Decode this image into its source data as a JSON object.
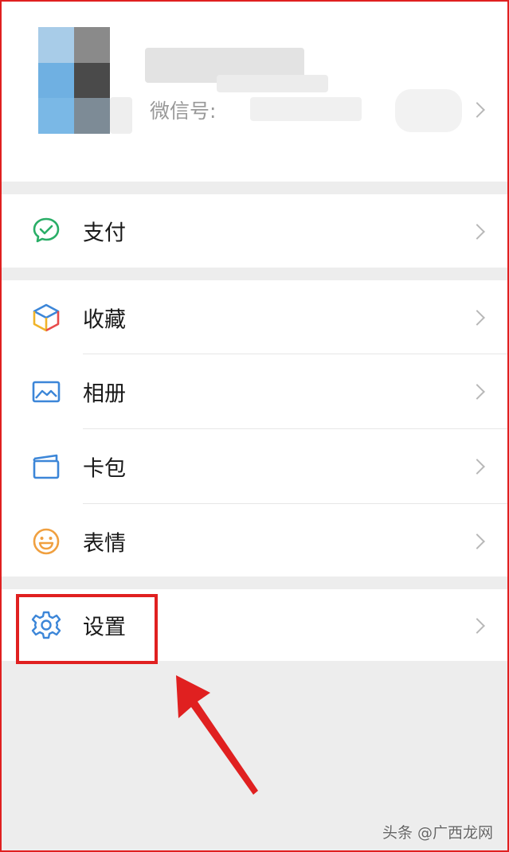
{
  "profile": {
    "wechat_id_label": "微信号:"
  },
  "menu": {
    "pay": "支付",
    "favorites": "收藏",
    "album": "相册",
    "cards": "卡包",
    "stickers": "表情",
    "settings": "设置"
  },
  "watermark": "头条 @广西龙网",
  "colors": {
    "highlight": "#e02020",
    "pay_green": "#2aae67",
    "icon_blue": "#3c86d8",
    "sticker_orange": "#f0a040"
  },
  "icons": {
    "pay": "wechat-pay-icon",
    "favorites": "cube-icon",
    "album": "picture-icon",
    "cards": "wallet-icon",
    "stickers": "smile-icon",
    "settings": "gear-icon",
    "chevron": "chevron-right-icon"
  }
}
